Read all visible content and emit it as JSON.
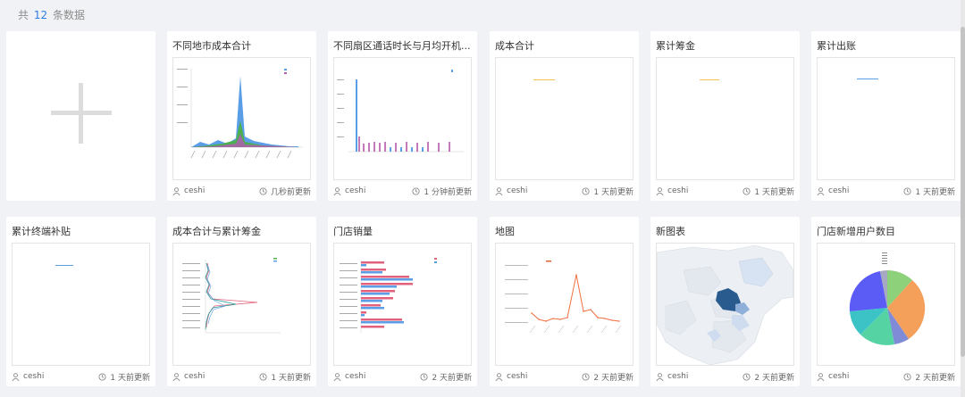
{
  "summary": {
    "prefix": "共",
    "count": "12",
    "suffix": "条数据"
  },
  "cards": [
    {
      "title": "不同地市成本合计",
      "user": "ceshi",
      "time": "几秒前更新"
    },
    {
      "title": "不同扇区通话时长与月均开机...",
      "user": "ceshi",
      "time": "1 分钟前更新"
    },
    {
      "title": "成本合计",
      "user": "ceshi",
      "time": "1 天前更新"
    },
    {
      "title": "累计筹金",
      "user": "ceshi",
      "time": "1 天前更新"
    },
    {
      "title": "累计出账",
      "user": "ceshi",
      "time": "1 天前更新"
    },
    {
      "title": "累计终端补贴",
      "user": "ceshi",
      "time": "1 天前更新"
    },
    {
      "title": "成本合计与累计筹金",
      "user": "ceshi",
      "time": "1 天前更新"
    },
    {
      "title": "门店销量",
      "user": "ceshi",
      "time": "2 天前更新"
    },
    {
      "title": "地图",
      "user": "ceshi",
      "time": "2 天前更新"
    },
    {
      "title": "新图表",
      "user": "ceshi",
      "time": "2 天前更新"
    },
    {
      "title": "门店新增用户数目",
      "user": "ceshi",
      "time": "2 天前更新"
    }
  ],
  "icons": {
    "add": "plus-icon",
    "user": "user-icon",
    "time": "clock-icon"
  },
  "colors": {
    "accent": "#2f7de1",
    "blue": "#5a9ee8",
    "pink": "#e0627c",
    "green": "#4caf50",
    "orange": "#f28c3a"
  }
}
